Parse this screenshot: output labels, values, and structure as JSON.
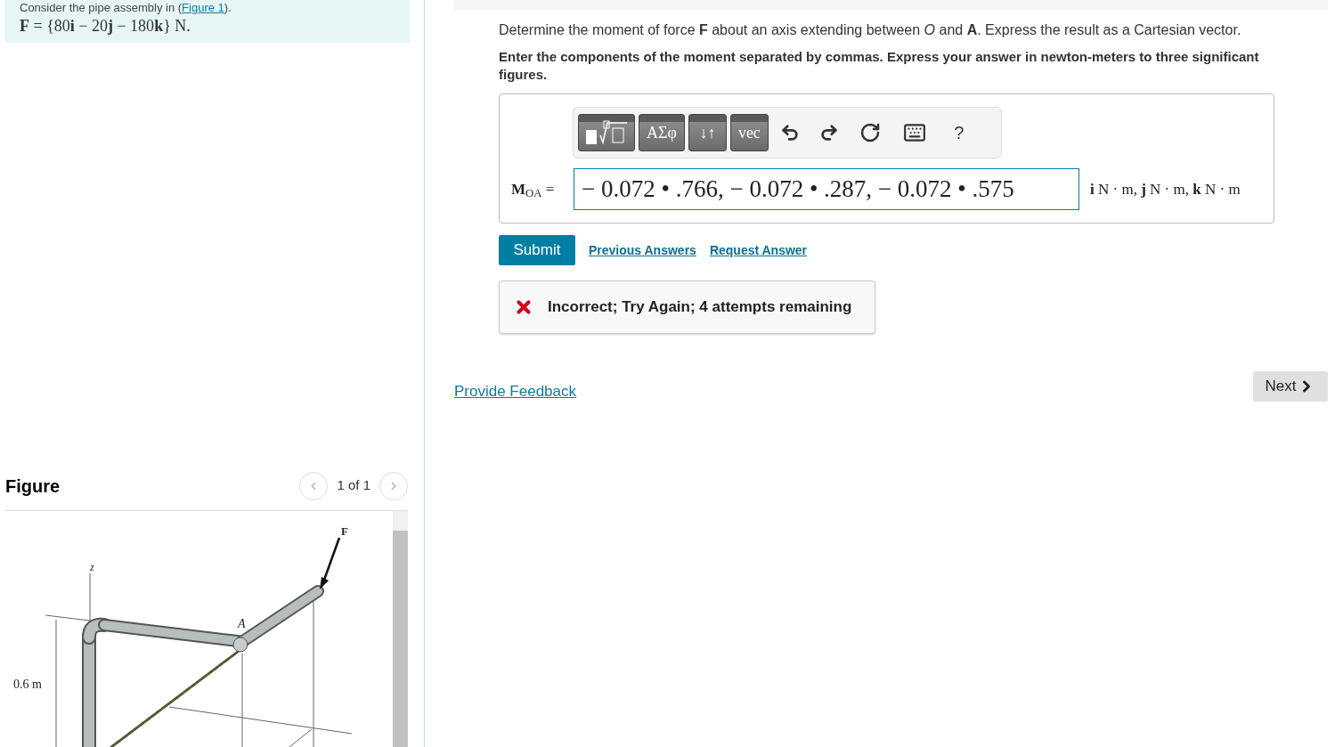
{
  "problem": {
    "intro_before": "Consider the pipe assembly in (",
    "intro_link": "Figure 1",
    "intro_after": ").",
    "force": "**F** = {80**i** − 20**j** − 180**k**} N."
  },
  "figure": {
    "title": "Figure",
    "pager": "1 of 1",
    "labels": [
      {
        "kind": "z",
        "text": "z"
      },
      {
        "kind": "F",
        "text": "F"
      },
      {
        "kind": "A",
        "text": "A"
      },
      {
        "kind": "dim",
        "text": "0.6 m"
      }
    ]
  },
  "question": {
    "text": "Determine the moment of force **F** about an axis extending between *O* and **A**. Express the result as a Cartesian vector.",
    "instruction": "Enter the components of the moment separated by commas. Express your answer in newton-meters to three significant figures."
  },
  "toolbar": [
    {
      "kind": "template"
    },
    {
      "kind": "text",
      "label": "ΑΣφ"
    },
    {
      "kind": "text",
      "label": "↓↑"
    },
    {
      "kind": "text",
      "label": "vec"
    },
    {
      "kind": "undo"
    },
    {
      "kind": "redo"
    },
    {
      "kind": "reset"
    },
    {
      "kind": "keyboard"
    },
    {
      "kind": "help",
      "label": "?"
    }
  ],
  "answer": {
    "label": "**M**$_{OA}$ =",
    "value": "− 0.072 • .766, − 0.072 • .287, − 0.072 • .575",
    "units": "**i** N · m, **j** N · m, **k** N · m"
  },
  "actions": {
    "submit": "Submit",
    "links": [
      "Previous Answers",
      "Request Answer"
    ]
  },
  "feedback": {
    "kind": "incorrect",
    "message": "Incorrect; Try Again; 4 attempts remaining"
  },
  "provide_feedback": "Provide Feedback",
  "next_button": "Next"
}
